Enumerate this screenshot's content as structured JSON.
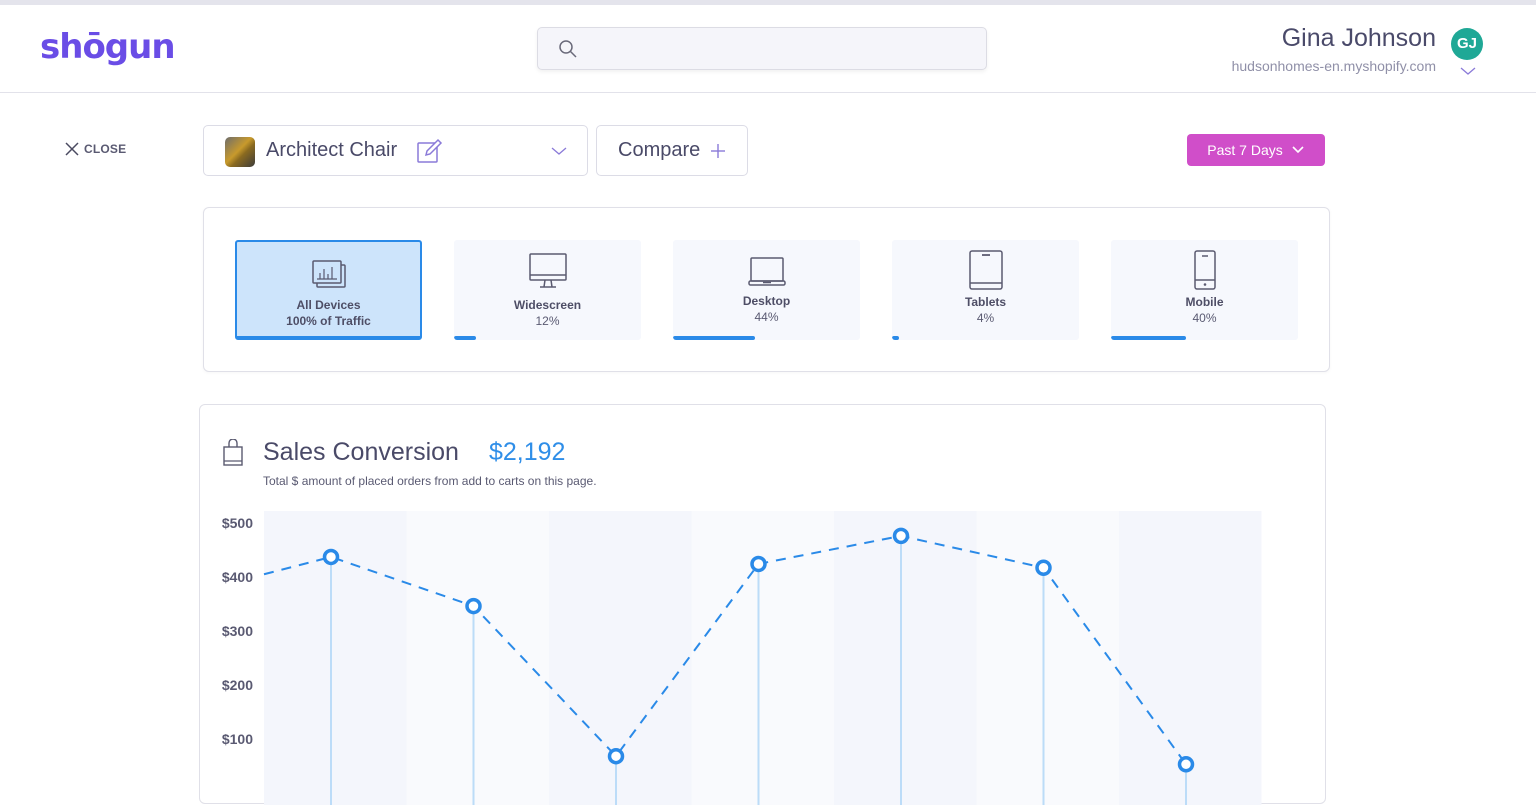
{
  "header": {
    "logo": "shōgun",
    "search": {
      "placeholder": "",
      "value": ""
    },
    "user": {
      "name": "Gina Johnson",
      "initials": "GJ",
      "store": "hudsonhomes-en.myshopify.com",
      "avatar_color": "#1fa896"
    }
  },
  "toolbar": {
    "close_label": "CLOSE",
    "product": {
      "name": "Architect Chair"
    },
    "compare_label": "Compare",
    "period_label": "Past 7 Days",
    "period_color": "#d04ec9"
  },
  "devices": [
    {
      "name": "All Devices",
      "pct_label": "100% of Traffic",
      "share": 100,
      "active": true,
      "icon": "analytics-icon"
    },
    {
      "name": "Widescreen",
      "pct_label": "12%",
      "share": 12,
      "active": false,
      "icon": "monitor-icon"
    },
    {
      "name": "Desktop",
      "pct_label": "44%",
      "share": 44,
      "active": false,
      "icon": "laptop-icon"
    },
    {
      "name": "Tablets",
      "pct_label": "4%",
      "share": 4,
      "active": false,
      "icon": "tablet-icon"
    },
    {
      "name": "Mobile",
      "pct_label": "40%",
      "share": 40,
      "active": false,
      "icon": "mobile-icon"
    }
  ],
  "sales": {
    "title": "Sales Conversion",
    "total": "$2,192",
    "subtitle": "Total $ amount of placed orders from add to carts on this page."
  },
  "chart_data": {
    "type": "line",
    "title": "Sales Conversion",
    "xlabel": "",
    "ylabel": "",
    "ylim": [
      0,
      520
    ],
    "yticks": [
      500,
      400,
      300,
      200,
      100
    ],
    "ytick_labels": [
      "$500",
      "$400",
      "$300",
      "$200",
      "$100"
    ],
    "series": [
      {
        "name": "Sales",
        "line_style": "dashed",
        "color": "#2a8ae8",
        "lead_in_value": 407,
        "values": [
          439,
          348,
          70,
          426,
          478,
          419,
          55
        ]
      }
    ],
    "column_count": 7,
    "grid": false
  }
}
